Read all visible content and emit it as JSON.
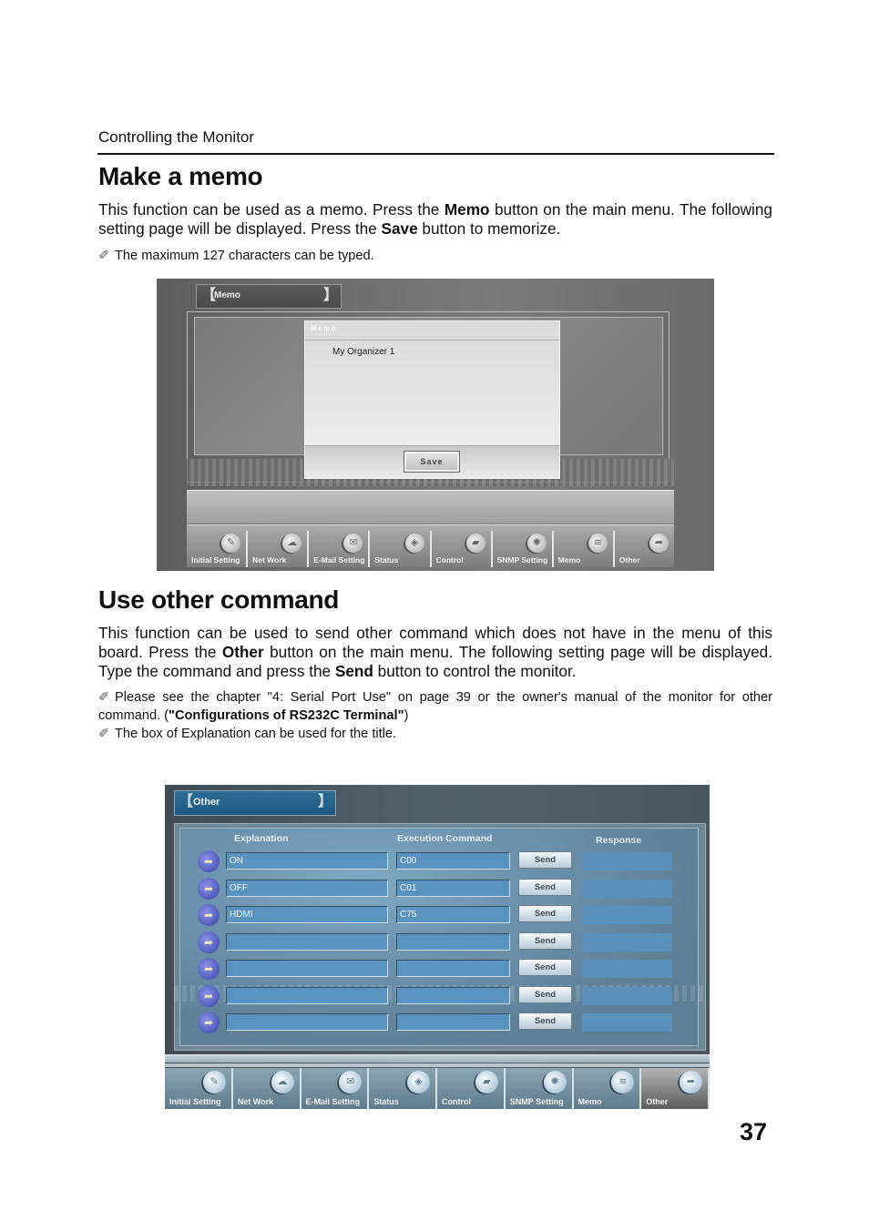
{
  "running_head": "Controlling the Monitor",
  "page_number": "37",
  "memo_section": {
    "heading": "Make a memo",
    "para_parts": [
      "This function can be used as a memo. Press the ",
      "Memo",
      " button on the main menu. The fol­lowing setting page will be displayed.  Press the ",
      "Save",
      " button to memorize."
    ],
    "note": "The maximum 127 characters can be typed.",
    "screenshot": {
      "title": "Memo",
      "dialog_title": "Memo",
      "memo_text": "My Organizer 1",
      "save_label": "Save",
      "nav": [
        {
          "label": "Initial Setting",
          "icon": "pen-icon"
        },
        {
          "label": "Net Work",
          "icon": "network-icon"
        },
        {
          "label": "E-Mail Setting",
          "icon": "mail-icon"
        },
        {
          "label": "Status",
          "icon": "status-icon"
        },
        {
          "label": "Control",
          "icon": "control-icon"
        },
        {
          "label": "SNMP Setting",
          "icon": "snmp-icon"
        },
        {
          "label": "Memo",
          "icon": "memo-icon"
        },
        {
          "label": "Other",
          "icon": "other-icon"
        }
      ]
    }
  },
  "other_section": {
    "heading": "Use other command",
    "para_parts": [
      "This function can be used to send other command which does not have in the menu of this board. Press the ",
      "Other",
      " button on the main menu. The following setting page will be dis­played.  Type the command and press the ",
      "Send",
      " button to control the monitor."
    ],
    "note1_parts": [
      "Please see the chapter \"4: Serial Port Use\" on page 39 or the owner's manual of the monitor for other command. (",
      "\"Configurations of RS232C Terminal\"",
      ")"
    ],
    "note2": "The box of Explanation can be used for the title.",
    "screenshot": {
      "title": "Other",
      "columns": {
        "explanation": "Explanation",
        "command": "Execution Command",
        "response": "Response"
      },
      "send_label": "Send",
      "rows": [
        {
          "explanation": "ON",
          "command": "C00",
          "response": ""
        },
        {
          "explanation": "OFF",
          "command": "C01",
          "response": ""
        },
        {
          "explanation": "HDMI",
          "command": "C75",
          "response": ""
        },
        {
          "explanation": "",
          "command": "",
          "response": ""
        },
        {
          "explanation": "",
          "command": "",
          "response": ""
        },
        {
          "explanation": "",
          "command": "",
          "response": ""
        },
        {
          "explanation": "",
          "command": "",
          "response": ""
        }
      ],
      "active_nav": "Other",
      "nav": [
        {
          "label": "Initial Setting",
          "icon": "pen-icon"
        },
        {
          "label": "Net Work",
          "icon": "network-icon"
        },
        {
          "label": "E-Mail Setting",
          "icon": "mail-icon"
        },
        {
          "label": "Status",
          "icon": "status-icon"
        },
        {
          "label": "Control",
          "icon": "control-icon"
        },
        {
          "label": "SNMP Setting",
          "icon": "snmp-icon"
        },
        {
          "label": "Memo",
          "icon": "memo-icon"
        },
        {
          "label": "Other",
          "icon": "other-icon"
        }
      ]
    }
  }
}
